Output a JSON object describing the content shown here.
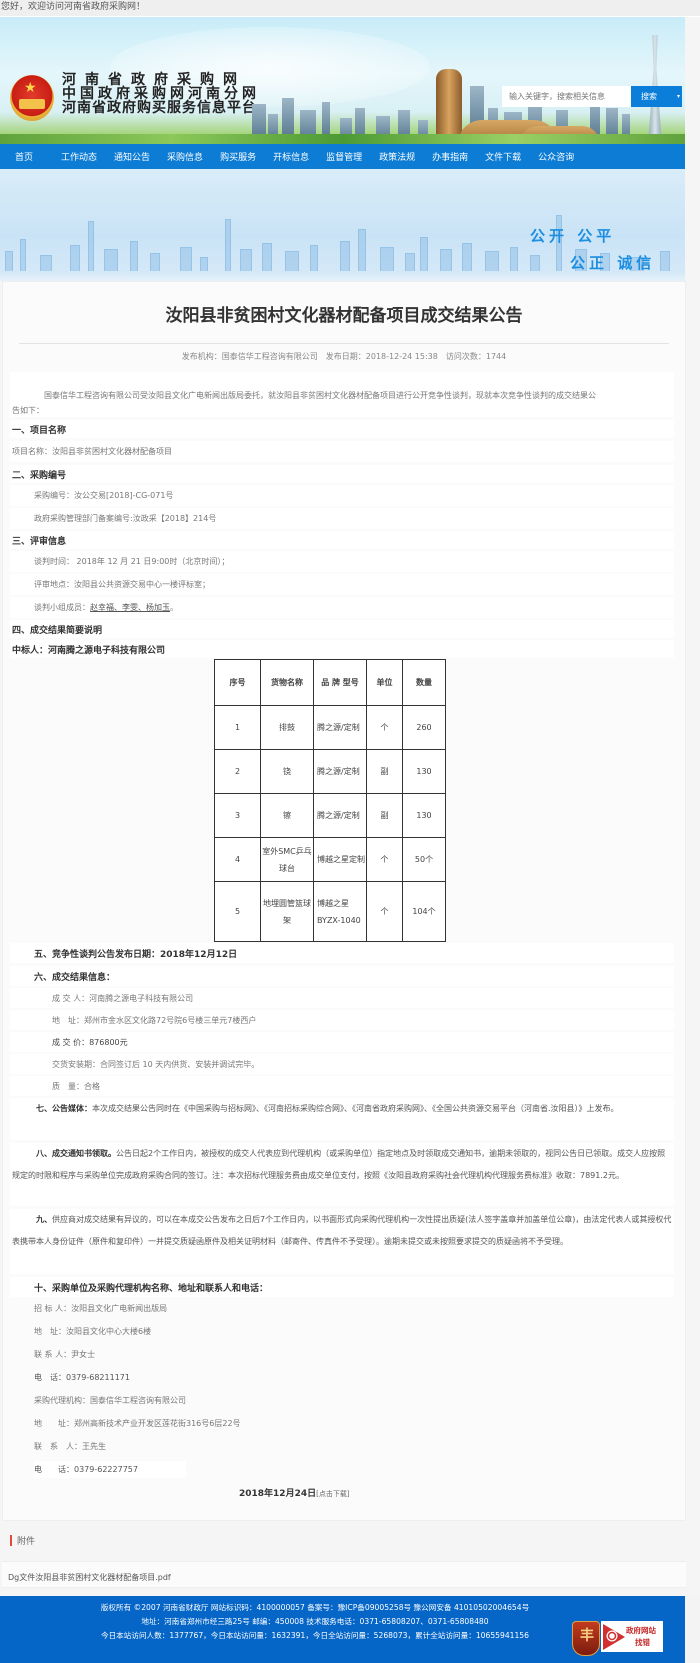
{
  "topbar": {
    "welcome": "您好，欢迎访问河南省政府采购网！"
  },
  "header": {
    "title_lines": [
      "河南省政府采购网",
      "中国政府采购网河南分网",
      "河南省政府购买服务信息平台"
    ],
    "search_placeholder": "输入关键字，搜索相关信息",
    "search_button": "搜索",
    "search_caret": "▾",
    "emblem_star": "★"
  },
  "nav": {
    "items": [
      "首页",
      "工作动态",
      "通知公告",
      "采购信息",
      "购买服务",
      "开标信息",
      "监督管理",
      "政策法规",
      "办事指南",
      "文件下载",
      "公众咨询"
    ]
  },
  "hero": {
    "slogan_line1": "公开  公平",
    "slogan_line2": "公正  诚信"
  },
  "article": {
    "title": "汝阳县非贫困村文化器材配备项目成交结果公告",
    "meta": "发布机构：国泰信华工程咨询有限公司　发布日期：2018-12-24 15:38　访问次数：1744",
    "intro_1": "国泰信华工程咨询有限公司受汝阳县文化广电新闻出版局委托，就汝阳县非贫困村文化器材配备项目进行公开竞争性谈判，现就本次竞争性谈判的成交结果公",
    "intro_2": "告如下：",
    "s1_title": "一、项目名称",
    "s1_name": "项目名称：汝阳县非贫困村文化器材配备项目",
    "s2_title": "二、采购编号",
    "s2_code": "采购编号：汝公交易[2018]-CG-071号",
    "s2_record": "政府采购管理部门备案编号:汝政采【2018】214号",
    "s3_title": "三、评审信息",
    "s3_time": "谈判时间： 2018年 12 月 21 日9:00时（北京时间）；",
    "s3_place": "评审地点：汝阳县公共资源交易中心一楼评标室；",
    "s3_members_label": "谈判小组成员：",
    "s3_members": "赵幸福、李雯、杨加玉",
    "s3_members_end": "。",
    "s4_title": "四、成交结果简要说明",
    "s4_winner": "中标人：河南腾之源电子科技有限公司",
    "table": {
      "headers": [
        "序号",
        "货物名称",
        "品 牌 型号",
        "单位",
        "数量"
      ],
      "rows": [
        [
          "1",
          "排鼓",
          "腾之源/定制",
          "个",
          "260"
        ],
        [
          "2",
          "铙",
          "腾之源/定制",
          "副",
          "130"
        ],
        [
          "3",
          "镲",
          "腾之源/定制",
          "副",
          "130"
        ],
        [
          "4",
          "室外SMC乒乓球台",
          "博越之星定制",
          "个",
          "50个"
        ],
        [
          "5",
          "地埋圆管篮球架",
          "博越之星BYZX-1040",
          "个",
          "104个"
        ]
      ]
    },
    "s5": "五、竞争性谈判公告发布日期：2018年12月12日",
    "s6_title": "六、成交结果信息：",
    "s6_winner": "成 交 人：河南腾之源电子科技有限公司",
    "s6_address": "地　址：郑州市金水区文化路72号院6号楼三单元7楼西户",
    "s6_price": "成 交 价：876800元",
    "s6_delivery": "交货安装期：合同签订后 10 天内供货、安装并调试完毕。",
    "s6_quality": "质　量：合格",
    "s7_label": "七、公告媒体：",
    "s7_text": "本次成交结果公告同时在《中国采购与招标网》、《河南招标采购综合网》、《河南省政府采购网》、《全国公共资源交易平台（河南省.汝阳县）》上发布。",
    "s8_label": "八、成交通知书领取。",
    "s8_text": "公告日起2个工作日内，被授权的成交人代表应到代理机构（或采购单位）指定地点及时领取成交通知书，逾期未领取的，视同公告日已领取。成交人应按照规定的时限和程序与采购单位完成政府采购合同的签订。注：本次招标代理服务费由成交单位支付，按照《汝阳县政府采购社会代理机构代理服务费标准》收取：7891.2元。",
    "s9_label": "九、",
    "s9_text": "供应商对成交结果有异议的，可以在本成交公告发布之日后7个工作日内，以书面形式向采购代理机构一次性提出质疑(法人签字盖章并加盖单位公章)，由法定代表人或其授权代表携带本人身份证件（原件和复印件）一并提交质疑函原件及相关证明材料（邮寄件、传真件不予受理）。逾期未提交或未按照要求提交的质疑函将不予受理。",
    "s10_title": "十、采购单位及采购代理机构名称、地址和联系人和电话：",
    "s10_lines": [
      "招 标 人：汝阳县文化广电新闻出版局",
      "地　址：汝阳县文化中心大楼6楼",
      "联 系 人：尹女士",
      "电　话：0379-68211171",
      "采购代理机构：国泰信华工程咨询有限公司",
      "地　　址：郑州高新技术产业开发区莲花街316号6层22号",
      "联　系　人：王先生",
      "电　　话：0379-62227757"
    ],
    "sign_date": "2018年12月24日",
    "download_link": "[点击下载]"
  },
  "attachment": {
    "heading": "附件",
    "file": "Dg文件汝阳县非贫困村文化器材配备项目.pdf"
  },
  "footer": {
    "line1": "版权所有 ©2007 河南省财政厅 网站标识码：4100000057 备案号：豫ICP备09005258号 豫公网安备 41010502004654号",
    "line2": "地址：河南省郑州市经三路25号 邮编：450008 技术服务电话：0371-65808207、0371-65808480",
    "line3": "今日本站访问人数：1377767，今日本站访问量：1632391，今日全站访问量：5268073，累计全站访问量：10655941156",
    "badge_left_glyph": "丰",
    "badge_right_line1": "政府网站",
    "badge_right_line2": "找错"
  },
  "colors": {
    "nav_blue": "#0c7cd5",
    "footer_blue": "#0566c7",
    "slogan": "#1d8ee0",
    "attach_bar": "#e24a3b"
  }
}
